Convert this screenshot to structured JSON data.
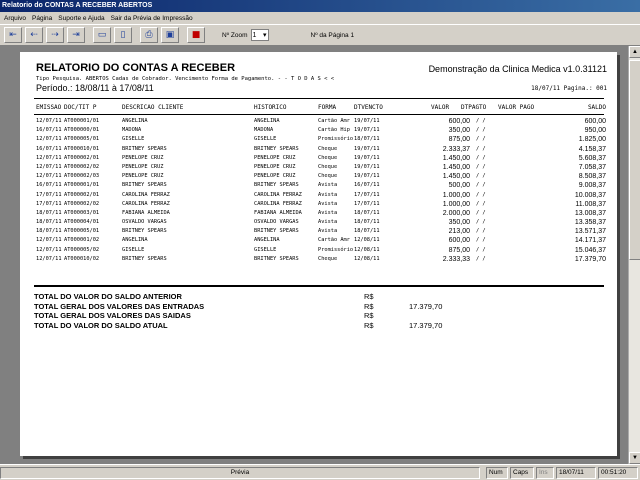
{
  "window": {
    "title": "Relatorio do CONTAS A RECEBER ABERTOS"
  },
  "menu": [
    "Arquivo",
    "Página",
    "Suporte e Ajuda",
    "Sair da Prévia de Impressão"
  ],
  "toolbar": {
    "buttons": [
      {
        "name": "first-page-icon",
        "glyph": "⇤"
      },
      {
        "name": "prev-page-icon",
        "glyph": "⇠"
      },
      {
        "name": "next-page-icon",
        "glyph": "⇢"
      },
      {
        "name": "last-page-icon",
        "glyph": "⇥"
      },
      {
        "name": "page-view-icon",
        "glyph": "▭"
      },
      {
        "name": "two-page-icon",
        "glyph": "▯"
      },
      {
        "name": "print-icon",
        "glyph": "⎙"
      },
      {
        "name": "export-icon",
        "glyph": "▣"
      },
      {
        "name": "close-icon",
        "glyph": "■"
      }
    ],
    "zoom_label": "Nº Zoom",
    "zoom_value": "1",
    "page_label": "Nº da Página 1"
  },
  "report": {
    "title": "RELATORIO DO CONTAS A RECEBER",
    "company": "Demonstração da Clinica Medica v1.0.31121",
    "filters": "Tipo Pesquisa. ABERTOS   Cadas de Cobrador. Vencimento  Forma de Pagamento. - - T O D A S < <",
    "periodo": "Período.: 18/08/11 à 17/08/11",
    "date_page": "18/07/11   Pagina.: 001",
    "headers": {
      "emissao": "EMISSAO",
      "doc": "DOC/TIT P",
      "cliente": "DESCRICAO CLIENTE",
      "historico": "HISTORICO",
      "forma": "FORMA",
      "vencimento": "DTVENCTO",
      "valor": "VALOR",
      "dtpag": "DTPAGTO",
      "valor_pago": "VALOR PAGO",
      "saldo": "SALDO"
    },
    "rows": [
      {
        "emissao": "12/07/11",
        "doc": "AT000001/01",
        "cliente": "ANGELINA",
        "historico": "ANGELINA",
        "forma": "Cartão Amr",
        "venc": "19/07/11",
        "valor": "600,00",
        "dtpag": "/  /",
        "saldo": "600,00"
      },
      {
        "emissao": "16/07/11",
        "doc": "AT000000/01",
        "cliente": "MADONA",
        "historico": "MADONA",
        "forma": "Cartão Hip",
        "venc": "19/07/11",
        "valor": "350,00",
        "dtpag": "/  /",
        "saldo": "950,00"
      },
      {
        "emissao": "12/07/11",
        "doc": "AT000005/01",
        "cliente": "GISELLE",
        "historico": "GISELLE",
        "forma": "Promissório",
        "venc": "18/07/11",
        "valor": "875,00",
        "dtpag": "/  /",
        "saldo": "1.825,00"
      },
      {
        "emissao": "16/07/11",
        "doc": "AT000010/01",
        "cliente": "BRITNEY SPEARS",
        "historico": "BRITNEY SPEARS",
        "forma": "Cheque",
        "venc": "19/07/11",
        "valor": "2.333,37",
        "dtpag": "/  /",
        "saldo": "4.158,37"
      },
      {
        "emissao": "12/07/11",
        "doc": "AT000002/01",
        "cliente": "PENELOPE CRUZ",
        "historico": "PENELOPE CRUZ",
        "forma": "Cheque",
        "venc": "19/07/11",
        "valor": "1.450,00",
        "dtpag": "/  /",
        "saldo": "5.608,37"
      },
      {
        "emissao": "12/07/11",
        "doc": "AT000002/02",
        "cliente": "PENELOPE CRUZ",
        "historico": "PENELOPE CRUZ",
        "forma": "Cheque",
        "venc": "19/07/11",
        "valor": "1.450,00",
        "dtpag": "/  /",
        "saldo": "7.058,37"
      },
      {
        "emissao": "12/07/11",
        "doc": "AT000002/03",
        "cliente": "PENELOPE CRUZ",
        "historico": "PENELOPE CRUZ",
        "forma": "Cheque",
        "venc": "19/07/11",
        "valor": "1.450,00",
        "dtpag": "/  /",
        "saldo": "8.508,37"
      },
      {
        "emissao": "16/07/11",
        "doc": "AT000001/01",
        "cliente": "BRITNEY SPEARS",
        "historico": "BRITNEY SPEARS",
        "forma": "Avista",
        "venc": "16/07/11",
        "valor": "500,00",
        "dtpag": "/  /",
        "saldo": "9.008,37"
      },
      {
        "emissao": "17/07/11",
        "doc": "AT000002/01",
        "cliente": "CAROLINA FERRAZ",
        "historico": "CAROLINA FERRAZ",
        "forma": "Avista",
        "venc": "17/07/11",
        "valor": "1.000,00",
        "dtpag": "/  /",
        "saldo": "10.008,37"
      },
      {
        "emissao": "17/07/11",
        "doc": "AT000002/02",
        "cliente": "CAROLINA FERRAZ",
        "historico": "CAROLINA FERRAZ",
        "forma": "Avista",
        "venc": "17/07/11",
        "valor": "1.000,00",
        "dtpag": "/  /",
        "saldo": "11.008,37"
      },
      {
        "emissao": "18/07/11",
        "doc": "AT000003/01",
        "cliente": "FABIANA ALMEIDA",
        "historico": "FABIANA ALMEIDA",
        "forma": "Avista",
        "venc": "18/07/11",
        "valor": "2.000,00",
        "dtpag": "/  /",
        "saldo": "13.008,37"
      },
      {
        "emissao": "18/07/11",
        "doc": "AT000004/01",
        "cliente": "OSVALDO VARGAS",
        "historico": "OSVALDO VARGAS",
        "forma": "Avista",
        "venc": "18/07/11",
        "valor": "350,00",
        "dtpag": "/  /",
        "saldo": "13.358,37"
      },
      {
        "emissao": "18/07/11",
        "doc": "AT000005/01",
        "cliente": "BRITNEY SPEARS",
        "historico": "BRITNEY SPEARS",
        "forma": "Avista",
        "venc": "18/07/11",
        "valor": "213,00",
        "dtpag": "/  /",
        "saldo": "13.571,37"
      },
      {
        "emissao": "12/07/11",
        "doc": "AT000001/02",
        "cliente": "ANGELINA",
        "historico": "ANGELINA",
        "forma": "Cartão Amr",
        "venc": "12/08/11",
        "valor": "600,00",
        "dtpag": "/  /",
        "saldo": "14.171,37"
      },
      {
        "emissao": "12/07/11",
        "doc": "AT000005/02",
        "cliente": "GISELLE",
        "historico": "GISELLE",
        "forma": "Promissório",
        "venc": "12/08/11",
        "valor": "875,00",
        "dtpag": "/  /",
        "saldo": "15.046,37"
      },
      {
        "emissao": "12/07/11",
        "doc": "AT000010/02",
        "cliente": "BRITNEY SPEARS",
        "historico": "BRITNEY SPEARS",
        "forma": "Cheque",
        "venc": "12/08/11",
        "valor": "2.333,33",
        "dtpag": "/  /",
        "saldo": "17.379,70"
      }
    ],
    "totals": [
      {
        "label": "TOTAL DO VALOR DO SALDO ANTERIOR",
        "currency": "R$",
        "value": ""
      },
      {
        "label": "TOTAL GERAL DOS VALORES DAS ENTRADAS",
        "currency": "R$",
        "value": "17.379,70"
      },
      {
        "label": "TOTAL GERAL DOS VALORES DAS SAIDAS",
        "currency": "R$",
        "value": ""
      },
      {
        "label": "TOTAL DO VALOR DO SALDO ATUAL",
        "currency": "R$",
        "value": "17.379,70"
      }
    ]
  },
  "status": {
    "mode": "Prévia",
    "num": "Num",
    "caps": "Caps",
    "ins": "Ins",
    "date": "18/07/11",
    "time": "00:51:20"
  }
}
